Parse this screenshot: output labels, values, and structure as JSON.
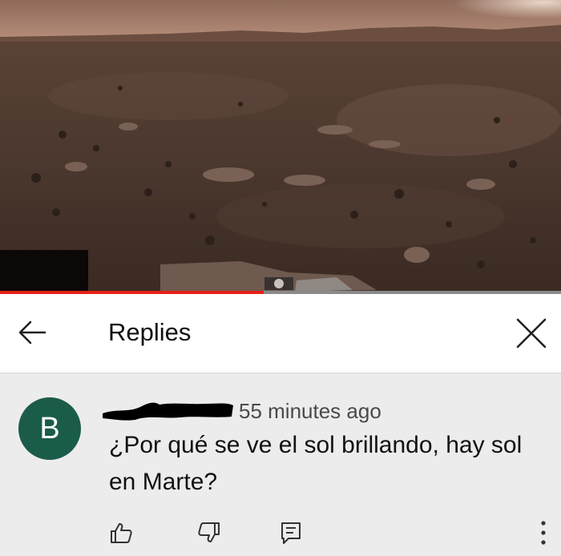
{
  "video": {
    "progress_fraction": 0.47,
    "progress_color": "#e62117"
  },
  "header": {
    "title": "Replies",
    "back_icon": "arrow-left-icon",
    "close_icon": "close-icon"
  },
  "comment": {
    "avatar_letter": "B",
    "avatar_color": "#1b5b4a",
    "timestamp": "55 minutes ago",
    "text": "¿Por qué se ve el sol brillando, hay sol en Marte?"
  },
  "actions": {
    "like_icon": "thumb-up-icon",
    "dislike_icon": "thumb-down-icon",
    "reply_icon": "reply-icon",
    "more_icon": "more-vertical-icon"
  }
}
